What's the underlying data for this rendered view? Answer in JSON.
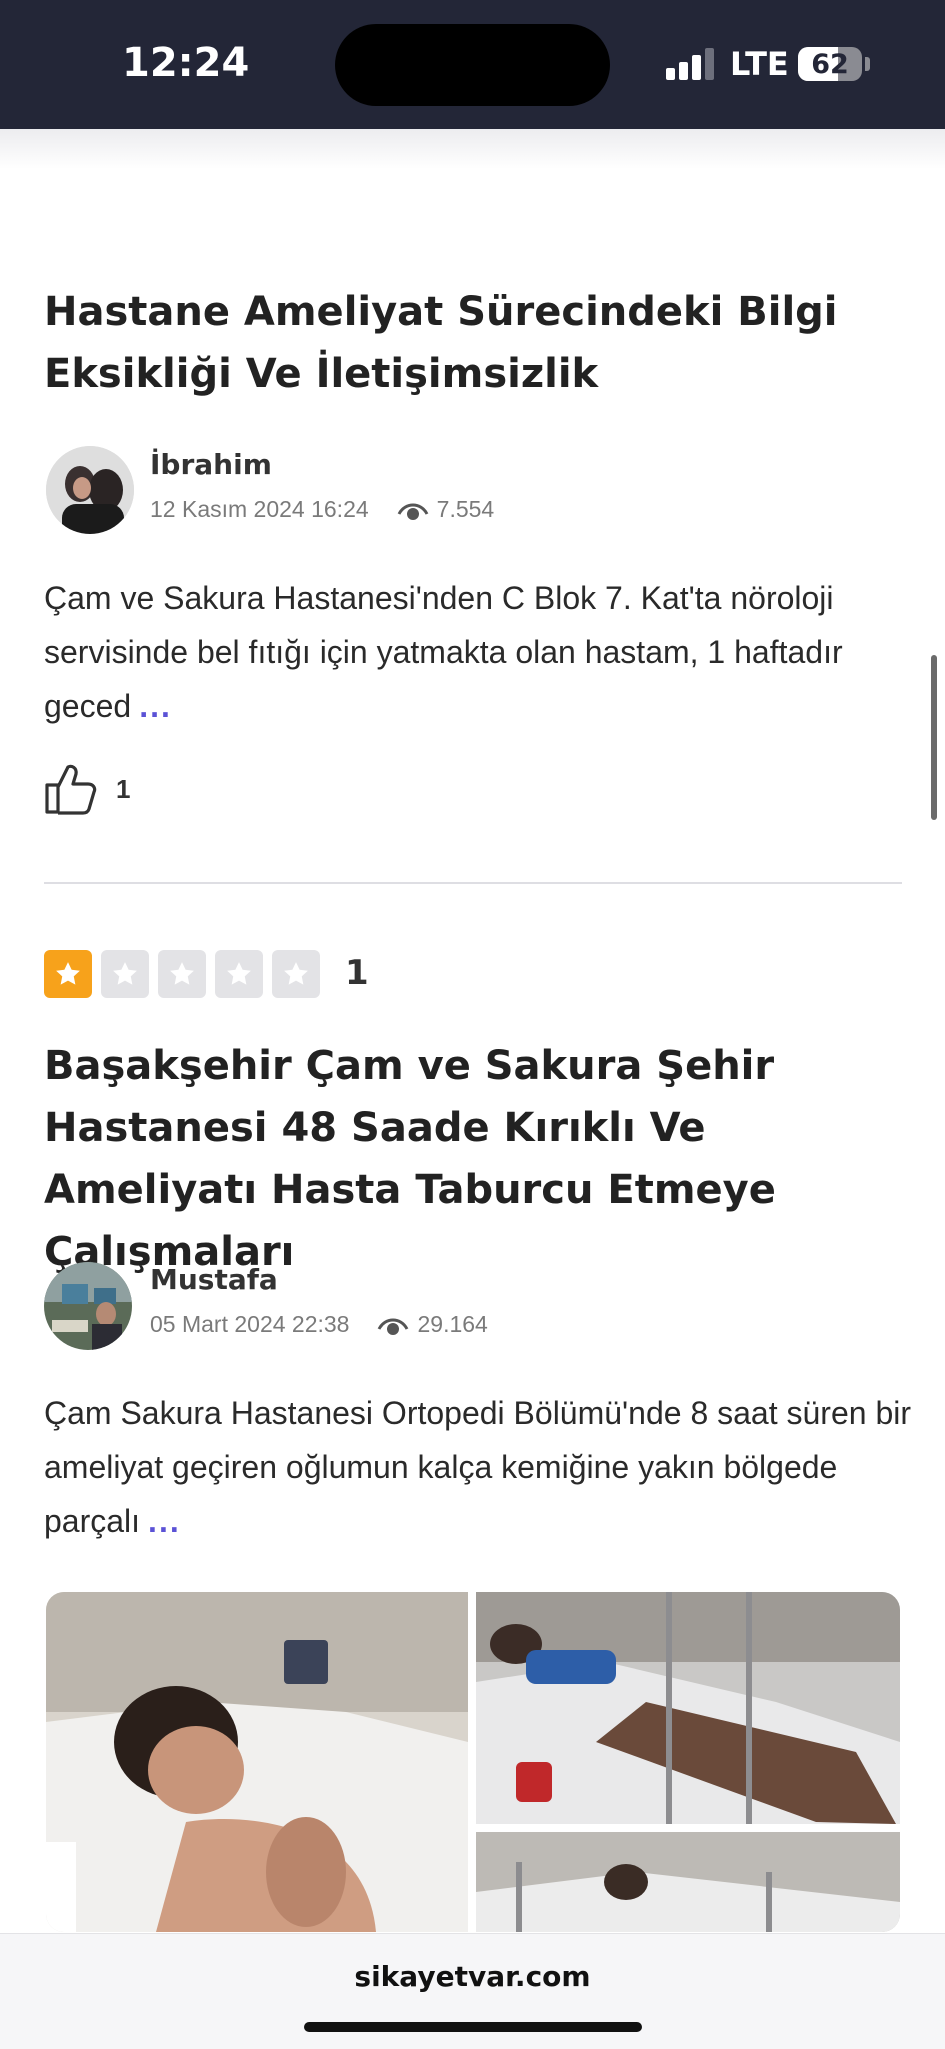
{
  "status_bar": {
    "time": "12:24",
    "network": "LTE",
    "battery": "62",
    "battery_level": 0.62
  },
  "posts": [
    {
      "title": "Hastane Ameliyat Sürecindeki Bilgi Eksikliği Ve İletişimsizlik",
      "author": "İbrahim",
      "date": "12 Kasım 2024 16:24",
      "views": "7.554",
      "excerpt": "Çam ve Sakura Hastanesi'nden C Blok 7. Kat'ta nöroloji servisinde bel fıtığı için yatmakta olan hastam, 1 haftadır geced",
      "more": "...",
      "likes": "1"
    },
    {
      "rating": "1",
      "rating_value": 1,
      "rating_max": 5,
      "title": "Başakşehir Çam ve Sakura Şehir Hastanesi 48 Saade Kırıklı Ve Ameliyatı Hasta Taburcu Etmeye Çalışmaları",
      "author": "Mustafa",
      "date": "05 Mart 2024 22:38",
      "views": "29.164",
      "excerpt": "Çam Sakura Hastanesi Ortopedi Bölümü'nde 8 saat süren bir ameliyat geçiren oğlumun kalça kemiğine yakın bölgede parçalı",
      "more": "..."
    }
  ],
  "browser": {
    "url": "sikayetvar.com"
  },
  "icons": {
    "like": "thumbs-up-icon",
    "views": "eye-icon",
    "star": "star-icon"
  },
  "colors": {
    "accent": "#5b52d6",
    "star_active": "#f7a21b",
    "status_bar": "#232637"
  }
}
